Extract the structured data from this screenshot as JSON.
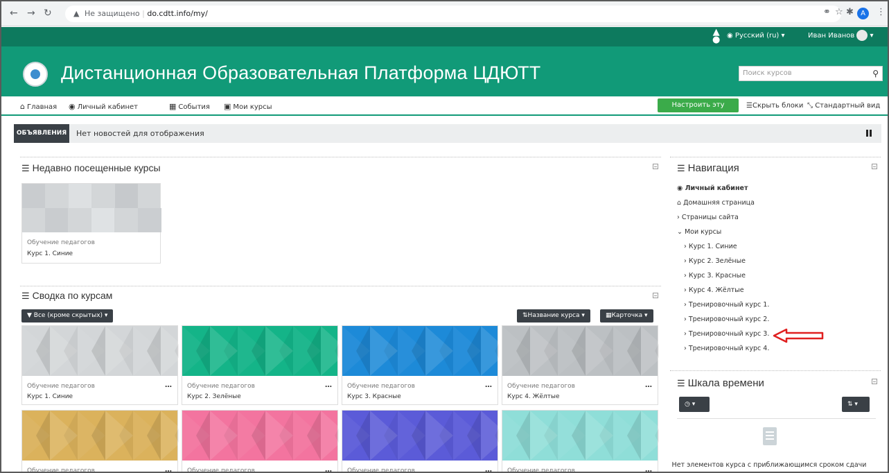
{
  "browser": {
    "security_label": "Не защищено",
    "url": "do.cdtt.info/my/"
  },
  "topbar": {
    "language": "Русский (ru)",
    "user_name": "Иван Иванов"
  },
  "header": {
    "title": "Дистанционная Образовательная Платформа ЦДЮТТ",
    "search_placeholder": "Поиск курсов"
  },
  "menu": {
    "items": [
      "Главная",
      "Личный кабинет",
      "События",
      "Мои курсы"
    ],
    "customize": "Настроить эту страницу",
    "hide_blocks": "Скрыть блоки",
    "standard_view": "Стандартный вид"
  },
  "announcements": {
    "tag": "ОБЪЯВЛЕНИЯ",
    "text": "Нет новостей для отображения"
  },
  "recent": {
    "title": "Недавно посещенные курсы",
    "card": {
      "category": "Обучение педагогов",
      "name": "Курс 1. Синие"
    }
  },
  "overview": {
    "title": "Сводка по курсам",
    "filter": "Все (кроме скрытых)",
    "sort": "Название курса",
    "view": "Карточка",
    "cards": [
      {
        "category": "Обучение педагогов",
        "name": "Курс 1. Синие",
        "color": "#d3d6d8"
      },
      {
        "category": "Обучение педагогов",
        "name": "Курс 2. Зелёные",
        "color": "#14b488"
      },
      {
        "category": "Обучение педагогов",
        "name": "Курс 3. Красные",
        "color": "#1d8ad8"
      },
      {
        "category": "Обучение педагогов",
        "name": "Курс 4. Жёлтые",
        "color": "#bcc0c3"
      },
      {
        "category": "Обучение педагогов",
        "name": "",
        "color": "#dbb25c"
      },
      {
        "category": "Обучение педагогов",
        "name": "",
        "color": "#f3749f"
      },
      {
        "category": "Обучение педагогов",
        "name": "",
        "color": "#5b5bd8"
      },
      {
        "category": "Обучение педагогов",
        "name": "",
        "color": "#8fded8"
      }
    ]
  },
  "navigation": {
    "title": "Навигация",
    "items": [
      "Личный кабинет",
      "Домашняя страница",
      "Страницы сайта",
      "Мои курсы",
      "Курс 1. Синие",
      "Курс 2. Зелёные",
      "Курс 3. Красные",
      "Курс 4. Жёлтые",
      "Тренировочный курс 1.",
      "Тренировочный курс 2.",
      "Тренировочный курс 3.",
      "Тренировочный курс 4."
    ]
  },
  "timeline": {
    "title": "Шкала времени",
    "empty_text": "Нет элементов курса с приближающимся сроком сдачи"
  }
}
